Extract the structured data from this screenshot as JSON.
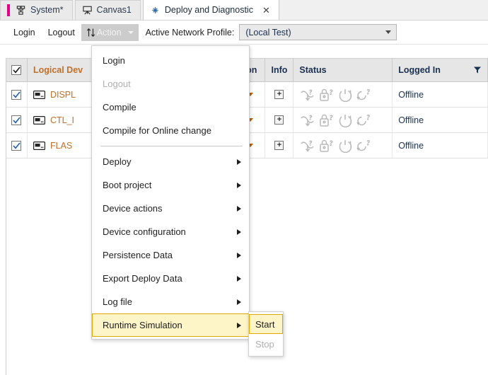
{
  "tabs": [
    {
      "label": "System*",
      "icon": "system-icon",
      "accent": "#e6008c",
      "active": false,
      "closable": false
    },
    {
      "label": "Canvas1",
      "icon": "canvas-easel-icon",
      "active": false,
      "closable": false
    },
    {
      "label": "Deploy and Diagnostic",
      "icon": "deploy-diagnostic-icon",
      "active": true,
      "closable": true,
      "close_label": "✕"
    }
  ],
  "toolbar": {
    "login_label": "Login",
    "logout_label": "Logout",
    "action_label": "Action",
    "profile_label": "Active Network Profile:",
    "profile_value": "(Local Test)"
  },
  "grid": {
    "headers": {
      "check": "",
      "name": "Logical Dev",
      "version": "",
      "action": "ion",
      "info": "Info",
      "status": "Status",
      "logged_in": "Logged In"
    },
    "header_checked": true,
    "rows": [
      {
        "checked": true,
        "name": "DISPL",
        "version": "",
        "info": "+",
        "status_icons": [
          "download-arrow-icon",
          "lock-question-icon",
          "power-warning-icon",
          "refresh-question-icon"
        ],
        "logged_in": "Offline"
      },
      {
        "checked": true,
        "name": "CTL_I",
        "version": "",
        "info": "+",
        "status_icons": [
          "download-arrow-icon",
          "lock-question-icon",
          "power-warning-icon",
          "refresh-question-icon"
        ],
        "logged_in": "Offline"
      },
      {
        "checked": true,
        "name": "FLAS",
        "version": "",
        "info": "+",
        "status_icons": [
          "download-arrow-icon",
          "lock-question-icon",
          "power-warning-icon",
          "refresh-question-icon"
        ],
        "logged_in": "Offline"
      }
    ]
  },
  "menu": {
    "items": [
      {
        "label": "Login",
        "disabled": false,
        "submenu": false,
        "highlight": false
      },
      {
        "label": "Logout",
        "disabled": true,
        "submenu": false,
        "highlight": false
      },
      {
        "label": "Compile",
        "disabled": false,
        "submenu": false,
        "highlight": false
      },
      {
        "label": "Compile for Online change",
        "disabled": false,
        "submenu": false,
        "highlight": false
      },
      {
        "separator": true
      },
      {
        "label": "Deploy",
        "disabled": false,
        "submenu": true,
        "highlight": false
      },
      {
        "label": "Boot project",
        "disabled": false,
        "submenu": true,
        "highlight": false
      },
      {
        "label": "Device actions",
        "disabled": false,
        "submenu": true,
        "highlight": false
      },
      {
        "label": "Device configuration",
        "disabled": false,
        "submenu": true,
        "highlight": false
      },
      {
        "label": "Persistence Data",
        "disabled": false,
        "submenu": true,
        "highlight": false
      },
      {
        "label": "Export Deploy Data",
        "disabled": false,
        "submenu": true,
        "highlight": false
      },
      {
        "label": "Log file",
        "disabled": false,
        "submenu": true,
        "highlight": false
      },
      {
        "label": "Runtime Simulation",
        "disabled": false,
        "submenu": true,
        "highlight": true
      }
    ]
  },
  "submenu": {
    "items": [
      {
        "label": "Start",
        "disabled": false,
        "highlight": true
      },
      {
        "label": "Stop",
        "disabled": true,
        "highlight": false
      }
    ]
  },
  "colors": {
    "accent_magenta": "#e6008c",
    "highlight_bg": "#fdf5c8",
    "highlight_border": "#e2a700",
    "header_bg": "#e6e6e6",
    "pressed_btn": "#cccccc",
    "link_text": "#1a3050",
    "device_name": "#c0702a"
  }
}
